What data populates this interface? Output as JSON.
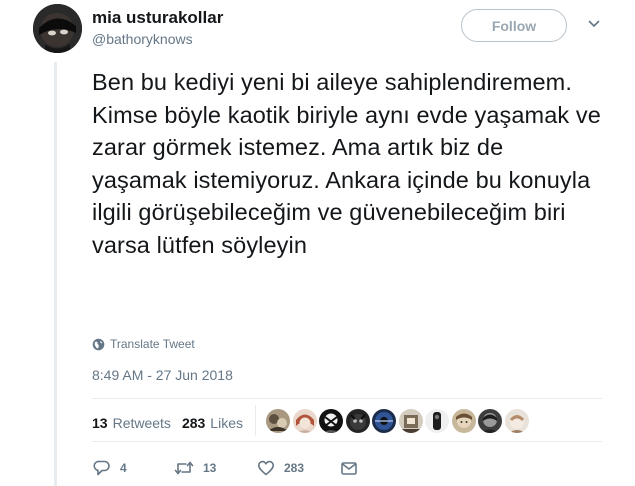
{
  "author": {
    "display_name": "mia usturakollar",
    "handle": "@bathoryknows",
    "avatar_icon": "avatar-icon"
  },
  "follow_button": {
    "label": "Follow"
  },
  "menu_icon": "chevron-down-icon",
  "tweet": {
    "text": "Ben bu kediyi yeni bi aileye sahiplendiremem. Kimse böyle kaotik biriyle aynı evde yaşamak ve zarar görmek istemez. Ama artık biz de yaşamak istemiyoruz. Ankara içinde bu konuyla ilgili görüşebileceğim ve güvenebileceğim biri varsa lütfen söyleyin",
    "translate_label": "Translate Tweet",
    "timestamp": "8:49 AM - 27 Jun 2018"
  },
  "stats": {
    "retweets": {
      "count": "13",
      "label": "Retweets"
    },
    "likes": {
      "count": "283",
      "label": "Likes"
    }
  },
  "liker_avatar_count": 10,
  "actions": {
    "reply": {
      "icon": "reply-icon",
      "count": "4"
    },
    "retweet": {
      "icon": "retweet-icon",
      "count": "13"
    },
    "like": {
      "icon": "heart-icon",
      "count": "283"
    },
    "message": {
      "icon": "envelope-icon"
    }
  },
  "colors": {
    "text": "#14171a",
    "muted": "#657786",
    "divider": "#e6ecf0",
    "follow_border": "#b9c2c9"
  }
}
